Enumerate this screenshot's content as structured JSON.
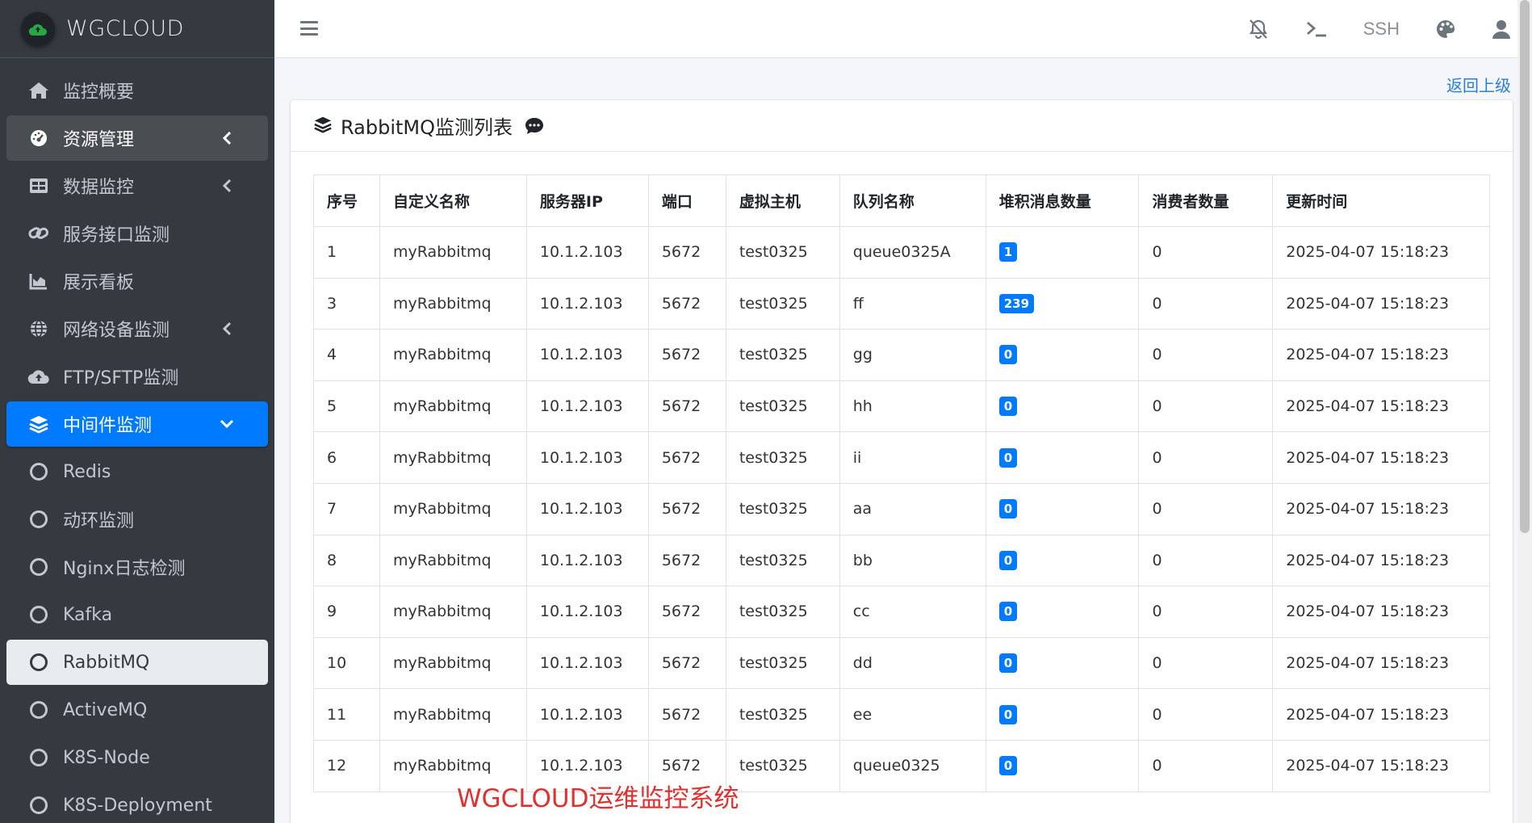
{
  "brand": {
    "name": "WGCLOUD"
  },
  "sidebar": {
    "items": [
      {
        "label": "监控概要",
        "icon": "home-icon"
      },
      {
        "label": "资源管理",
        "icon": "dashboard-icon"
      },
      {
        "label": "数据监控",
        "icon": "table-icon"
      },
      {
        "label": "服务接口监测",
        "icon": "link-icon"
      },
      {
        "label": "展示看板",
        "icon": "area-chart-icon"
      },
      {
        "label": "网络设备监测",
        "icon": "globe-icon"
      },
      {
        "label": "FTP/SFTP监测",
        "icon": "cloud-upload-icon"
      },
      {
        "label": "中间件监测",
        "icon": "layers-icon"
      },
      {
        "label": "Redis"
      },
      {
        "label": "动环监测"
      },
      {
        "label": "Nginx日志检测"
      },
      {
        "label": "Kafka"
      },
      {
        "label": "RabbitMQ"
      },
      {
        "label": "ActiveMQ"
      },
      {
        "label": "K8S-Node"
      },
      {
        "label": "K8S-Deployment"
      }
    ]
  },
  "header": {
    "ssh_label": "SSH"
  },
  "back_link": "返回上级",
  "card": {
    "title": "RabbitMQ监测列表"
  },
  "table": {
    "columns": [
      "序号",
      "自定义名称",
      "服务器IP",
      "端口",
      "虚拟主机",
      "队列名称",
      "堆积消息数量",
      "消费者数量",
      "更新时间"
    ],
    "rows": [
      [
        "1",
        "myRabbitmq",
        "10.1.2.103",
        "5672",
        "test0325",
        "queue0325A",
        "1",
        "0",
        "2025-04-07 15:18:23"
      ],
      [
        "3",
        "myRabbitmq",
        "10.1.2.103",
        "5672",
        "test0325",
        "ff",
        "239",
        "0",
        "2025-04-07 15:18:23"
      ],
      [
        "4",
        "myRabbitmq",
        "10.1.2.103",
        "5672",
        "test0325",
        "gg",
        "0",
        "0",
        "2025-04-07 15:18:23"
      ],
      [
        "5",
        "myRabbitmq",
        "10.1.2.103",
        "5672",
        "test0325",
        "hh",
        "0",
        "0",
        "2025-04-07 15:18:23"
      ],
      [
        "6",
        "myRabbitmq",
        "10.1.2.103",
        "5672",
        "test0325",
        "ii",
        "0",
        "0",
        "2025-04-07 15:18:23"
      ],
      [
        "7",
        "myRabbitmq",
        "10.1.2.103",
        "5672",
        "test0325",
        "aa",
        "0",
        "0",
        "2025-04-07 15:18:23"
      ],
      [
        "8",
        "myRabbitmq",
        "10.1.2.103",
        "5672",
        "test0325",
        "bb",
        "0",
        "0",
        "2025-04-07 15:18:23"
      ],
      [
        "9",
        "myRabbitmq",
        "10.1.2.103",
        "5672",
        "test0325",
        "cc",
        "0",
        "0",
        "2025-04-07 15:18:23"
      ],
      [
        "10",
        "myRabbitmq",
        "10.1.2.103",
        "5672",
        "test0325",
        "dd",
        "0",
        "0",
        "2025-04-07 15:18:23"
      ],
      [
        "11",
        "myRabbitmq",
        "10.1.2.103",
        "5672",
        "test0325",
        "ee",
        "0",
        "0",
        "2025-04-07 15:18:23"
      ],
      [
        "12",
        "myRabbitmq",
        "10.1.2.103",
        "5672",
        "test0325",
        "queue0325",
        "0",
        "0",
        "2025-04-07 15:18:23"
      ]
    ]
  },
  "watermark": "WGCLOUD运维监控系统",
  "colors": {
    "sidebar_bg": "#343a40",
    "accent": "#007bff",
    "watermark": "#e03030"
  }
}
